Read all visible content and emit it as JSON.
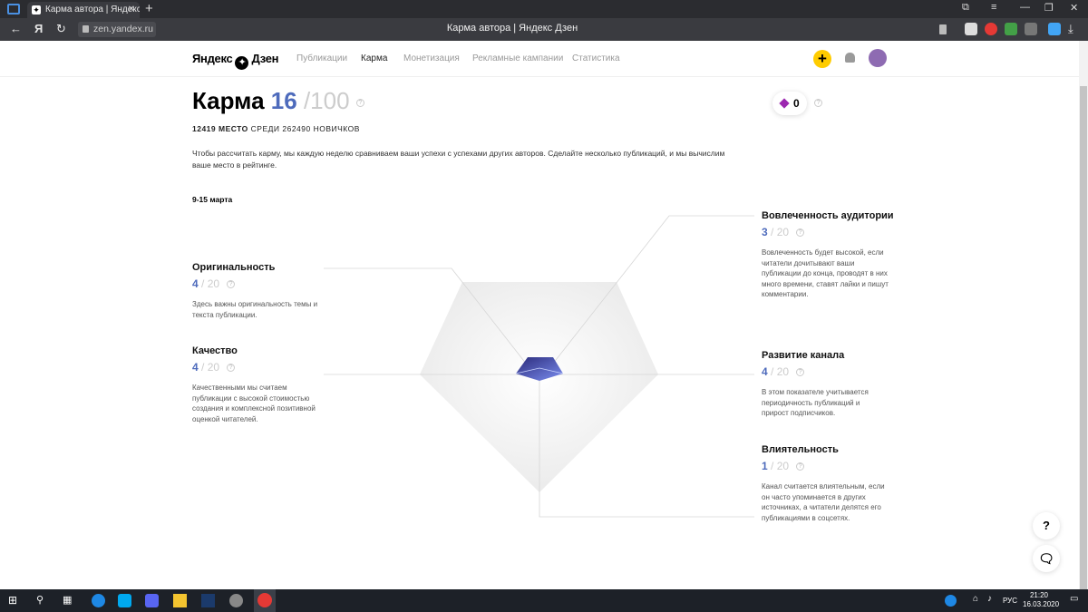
{
  "browser": {
    "tab_title": "Карма автора | Яндекс Д",
    "url": "zen.yandex.ru",
    "page_title": "Карма автора | Яндекс Дзен"
  },
  "header": {
    "logo": "Яндекс Дзен",
    "logo_left": "Яндекс",
    "logo_right": "Дзен",
    "nav": [
      "Публикации",
      "Карма",
      "Монетизация",
      "Рекламные кампании",
      "Статистика"
    ],
    "active_nav": "Карма",
    "plus_label": "+"
  },
  "karma": {
    "title": "Карма",
    "value": "16",
    "max": "/100",
    "rank_place": "12419 МЕСТО",
    "rank_rest": "СРЕДИ 262490 НОВИЧКОВ",
    "intro": "Чтобы рассчитать карму, мы каждую неделю сравниваем ваши успехи с успехами других авторов. Сделайте несколько публикаций, и мы вычислим ваше место в рейтинге.",
    "period": "9-15 марта",
    "gems": "0"
  },
  "metrics": {
    "originality": {
      "name": "Оригинальность",
      "value": "4",
      "max": "20",
      "desc": "Здесь важны оригинальность темы и текста публикации."
    },
    "quality": {
      "name": "Качество",
      "value": "4",
      "max": "20",
      "desc": "Качественными мы считаем публикации с высокой стоимостью создания и комплексной позитивной оценкой читателей."
    },
    "engagement": {
      "name": "Вовлеченность аудитории",
      "value": "3",
      "max": "20",
      "desc": "Вовлеченность будет высокой, если читатели дочитывают ваши публикации до конца, проводят в них много времени, ставят лайки и пишут комментарии."
    },
    "development": {
      "name": "Развитие канала",
      "value": "4",
      "max": "20",
      "desc": "В этом показателе учитывается периодичность публикаций и прирост подписчиков."
    },
    "influence": {
      "name": "Влиятельность",
      "value": "1",
      "max": "20",
      "desc": "Канал считается влиятельным, если он часто упоминается в других источниках, а читатели делятся его публикациями в соцсетях."
    }
  },
  "ui": {
    "help": "?",
    "float_help": "?"
  },
  "taskbar": {
    "lang": "РУС",
    "time": "21:20",
    "date": "16.03.2020"
  }
}
